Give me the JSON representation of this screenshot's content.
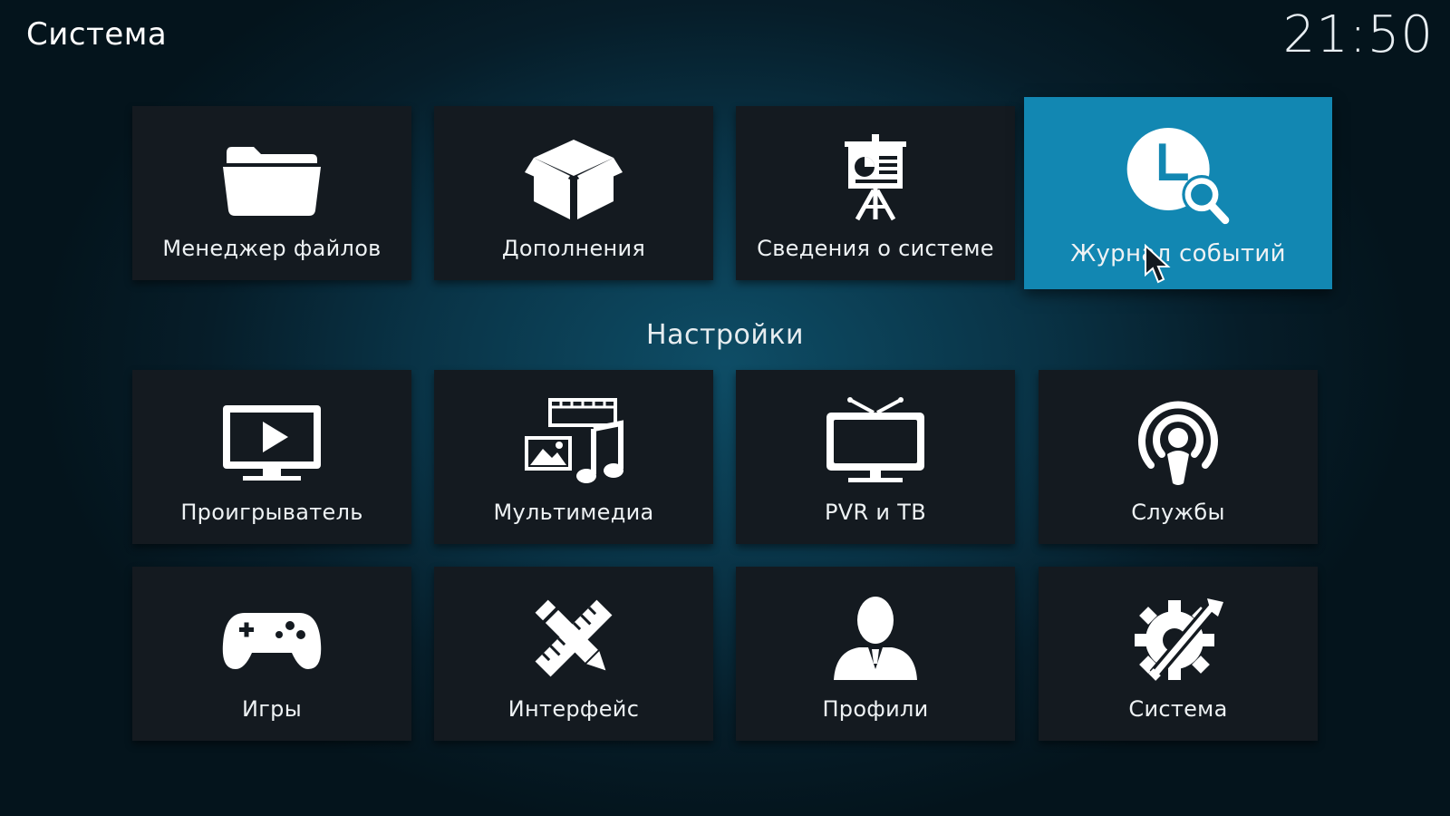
{
  "header": {
    "title": "Система",
    "clock": "21:50"
  },
  "top_row": [
    {
      "label": "Менеджер файлов",
      "icon": "folder-icon"
    },
    {
      "label": "Дополнения",
      "icon": "addons-box-icon"
    },
    {
      "label": "Сведения о системе",
      "icon": "presentation-chart-icon"
    },
    {
      "label": "Журнал событий",
      "icon": "event-log-clock-icon",
      "focused": true
    }
  ],
  "settings": {
    "heading": "Настройки",
    "items": [
      {
        "label": "Проигрыватель",
        "icon": "player-screen-icon"
      },
      {
        "label": "Мультимедиа",
        "icon": "media-icon"
      },
      {
        "label": "PVR и ТВ",
        "icon": "tv-icon"
      },
      {
        "label": "Службы",
        "icon": "podcast-services-icon"
      },
      {
        "label": "Игры",
        "icon": "gamepad-icon"
      },
      {
        "label": "Интерфейс",
        "icon": "pencil-ruler-icon"
      },
      {
        "label": "Профили",
        "icon": "user-profile-icon"
      },
      {
        "label": "Система",
        "icon": "gear-tools-icon"
      }
    ]
  },
  "colors": {
    "focus": "#1287b2",
    "tile": "#141a20"
  }
}
